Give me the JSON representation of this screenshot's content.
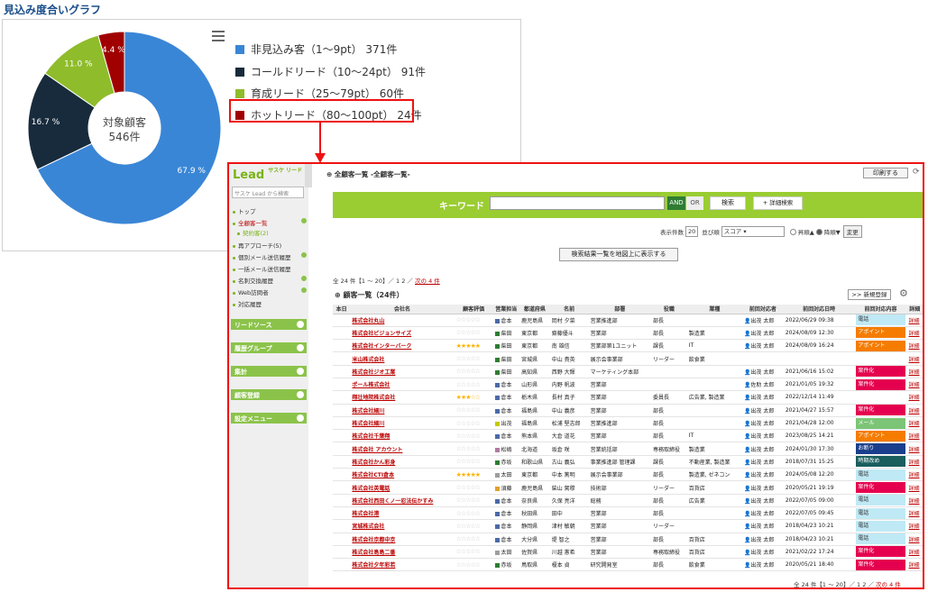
{
  "page_title": "見込み度合いグラフ",
  "chart_data": {
    "type": "pie",
    "center_label": "対象顧客",
    "center_value": "546件",
    "slices": [
      {
        "name": "非見込み客（1～9pt）",
        "count": "371件",
        "percent": 67.9,
        "label": "67.9 %",
        "color": "#3a86d6"
      },
      {
        "name": "コールドリード（10～24pt）",
        "count": "91件",
        "percent": 16.7,
        "label": "16.7 %",
        "color": "#172b3c"
      },
      {
        "name": "育成リード（25～79pt）",
        "count": "60件",
        "percent": 11.0,
        "label": "11.0 %",
        "color": "#8fbc2b"
      },
      {
        "name": "ホットリード（80～100pt）",
        "count": "24件",
        "percent": 4.4,
        "label": "4.4 %",
        "color": "#a00000"
      }
    ]
  },
  "app": {
    "logo": "Lead",
    "logo_sub": "サスケ リード",
    "search_placeholder": "サスケ Lead から検索",
    "nav": [
      {
        "label": "トップ",
        "selected": false,
        "sub": false
      },
      {
        "label": "全顧客一覧",
        "selected": true,
        "sub": false
      },
      {
        "label": "契約客(2)",
        "selected": false,
        "sub": true
      },
      {
        "label": "再アプローチ(5)",
        "selected": false,
        "sub": false
      },
      {
        "label": "個別メール送信履歴",
        "selected": false,
        "sub": false
      },
      {
        "label": "一括メール送信履歴",
        "selected": false,
        "sub": false
      },
      {
        "label": "名刺交換履歴",
        "selected": false,
        "sub": false
      },
      {
        "label": "Web訪問者",
        "selected": false,
        "sub": false
      },
      {
        "label": "対応履歴",
        "selected": false,
        "sub": false
      }
    ],
    "groups": [
      "リードソース",
      "履歴グループ",
      "集計",
      "顧客登録",
      "設定メニュー"
    ],
    "breadcrumb": "全顧客一覧 -全顧客一覧-",
    "print_label": "印刷する",
    "keyword_label": "キーワード",
    "and_label": "AND",
    "or_label": "OR",
    "search_label": "検索",
    "adv_search_label": "+ 詳細検索",
    "per_page_label": "表示件数",
    "per_page_value": "20",
    "sort_label": "並び順",
    "sort_value": "スコア",
    "asc_label": "昇順▲",
    "desc_label": "降順▼",
    "change_label": "変更",
    "map_label": "検索結果一覧を地図上に表示する",
    "count_text": "全 24 件【1 ～ 20】／ 1 2",
    "next_label": "次の 4 件",
    "list_title": "顧客一覧（24件）",
    "new_label": ">> 新規登録",
    "columns": [
      "本日",
      "会社名",
      "顧客評価",
      "営業担当",
      "都道府県",
      "名前",
      "部署",
      "役職",
      "業種",
      "前回対応者",
      "前回対応日時",
      "前回対応内容",
      "詳細"
    ],
    "rows": [
      [
        "株式会社丸山",
        "☆☆☆☆☆",
        "倉本",
        "鹿児島県",
        "岡村 夕菜",
        "営業推進部",
        "部長",
        "",
        "出茂 太郎",
        "2022/06/29 09:38",
        "電話",
        "詳細",
        false
      ],
      [
        "株式会社ビジョンサイズ",
        "☆☆☆☆☆",
        "柴田",
        "東京都",
        "齋藤優斗",
        "営業部",
        "部長",
        "製造業",
        "出茂 太郎",
        "2024/08/09 12:30",
        "アポイント",
        "詳細",
        false
      ],
      [
        "株式会社インターバーク",
        "★★★★★",
        "柴田",
        "東京都",
        "南 雄信",
        "営業部第1ユニット",
        "課長",
        "IT",
        "出茂 太郎",
        "2024/08/09 16:24",
        "アポイント",
        "詳細",
        true
      ],
      [
        "米山株式会社",
        "☆☆☆☆☆",
        "柴田",
        "宮城県",
        "中山 貴英",
        "展示会事業部",
        "リーダー",
        "飲食業",
        "",
        "",
        "",
        "詳細",
        false
      ],
      [
        "株式会社ジオ工業",
        "☆☆☆☆☆",
        "柴田",
        "高知県",
        "西野 大輝",
        "マーケティング本部",
        "",
        "",
        "出茂 太郎",
        "2021/06/16 15:02",
        "案件化",
        "詳細",
        false
      ],
      [
        "ポール株式会社",
        "☆☆☆☆☆",
        "倉本",
        "山形県",
        "内野 帆波",
        "営業部",
        "",
        "",
        "佐助 太郎",
        "2021/01/05 19:32",
        "案件化",
        "詳細",
        false
      ],
      [
        "翔壮地院株式会社",
        "★★★☆☆",
        "倉本",
        "栃木県",
        "長村 真子",
        "営業部",
        "委員長",
        "広告業, 製造業",
        "出茂 太郎",
        "2022/12/14 11:49",
        "",
        "詳細",
        true
      ],
      [
        "株式会社細川",
        "☆☆☆☆☆",
        "倉本",
        "福島県",
        "中山 義彦",
        "営業部",
        "部長",
        "",
        "出茂 太郎",
        "2021/04/27 15:57",
        "案件化",
        "詳細",
        false
      ],
      [
        "株式会社細川",
        "☆☆☆☆☆",
        "出茂",
        "福島県",
        "松浦 堅志郎",
        "営業推進部",
        "部長",
        "",
        "出茂 太郎",
        "2021/04/28 12:00",
        "メール",
        "詳細",
        false
      ],
      [
        "株式会社千葉翔",
        "☆☆☆☆☆",
        "倉本",
        "熊本県",
        "大倉 道花",
        "営業部",
        "部長",
        "IT",
        "出茂 太郎",
        "2023/08/25 14:21",
        "アポイント",
        "詳細",
        false
      ],
      [
        "株式会社 アカウント",
        "☆☆☆☆☆",
        "松嶋",
        "北海道",
        "坂倉 咲",
        "営業統括部",
        "専務取締役",
        "製造業",
        "出茂 太郎",
        "2024/01/30 17:30",
        "お断り",
        "詳細",
        false
      ],
      [
        "株式会社かん彩身",
        "☆☆☆☆☆",
        "赤坂",
        "和歌山県",
        "古山 義弘",
        "事業推進部 管理課",
        "課長",
        "不動産業, 製造業",
        "出茂 太郎",
        "2018/07/31 15:25",
        "時期改め",
        "詳細",
        false
      ],
      [
        "株式会社CTI倉本",
        "★★★★★",
        "太田",
        "東京都",
        "中本 篤明",
        "展示会事業部",
        "部長",
        "製造業, ゼネコン",
        "出茂 太郎",
        "2024/05/08 12:20",
        "電話",
        "詳細",
        true
      ],
      [
        "株式会社英電話",
        "☆☆☆☆☆",
        "須藤",
        "鹿児島県",
        "柴山 駕穆",
        "技術部",
        "リーダー",
        "百貨店",
        "出茂 太郎",
        "2020/05/21 19:19",
        "案件化",
        "詳細",
        false
      ],
      [
        "株式会社西田くノ一忍法伝かすみ",
        "☆☆☆☆☆",
        "倉本",
        "奈良県",
        "久保 亮洋",
        "総務",
        "部長",
        "広告業",
        "出茂 太郎",
        "2022/07/05 09:00",
        "電話",
        "詳細",
        false
      ],
      [
        "株式会社港",
        "☆☆☆☆☆",
        "倉本",
        "秋田県",
        "田中",
        "営業部",
        "部長",
        "",
        "出茂 太郎",
        "2022/07/05 09:45",
        "電話",
        "詳細",
        false
      ],
      [
        "宮城株式会社",
        "☆☆☆☆☆",
        "倉本",
        "静岡県",
        "津村 敏朝",
        "営業部",
        "リーダー",
        "",
        "出茂 太郎",
        "2018/04/23 10:21",
        "電話",
        "詳細",
        false
      ],
      [
        "株式会社京都中京",
        "☆☆☆☆☆",
        "倉本",
        "大分県",
        "堤 智之",
        "営業部",
        "部長",
        "百貨店",
        "出茂 太郎",
        "2018/04/23 10:21",
        "電話",
        "詳細",
        false
      ],
      [
        "株式会社島島二番",
        "☆☆☆☆☆",
        "太田",
        "佐賀県",
        "川越 憲希",
        "営業部",
        "専務取締役",
        "百貨店",
        "出茂 太郎",
        "2021/02/22 17:24",
        "案件化",
        "詳細",
        false
      ],
      [
        "株式会社夕年彩若",
        "☆☆☆☆☆",
        "赤坂",
        "鳥取県",
        "榎本 貞",
        "研究開発室",
        "部長",
        "飲食業",
        "出茂 太郎",
        "2020/05/21 18:40",
        "案件化",
        "詳細",
        false
      ]
    ],
    "footer_count": "全 24 件【1 ～ 20】／ 1 2",
    "footer_next": "次の 4 件",
    "tag_colors": {
      "電話": "#bfe9f5",
      "アポイント": "#f57c00",
      "案件化": "#e5004f",
      "メール": "#7cc576",
      "お断り": "#1a3e8c",
      "時期改め": "#1b5e5e"
    },
    "rep_colors": {
      "倉本": "#4a6aa8",
      "柴田": "#2e7d32",
      "出茂": "#c8c800",
      "松嶋": "#b07aa0",
      "赤坂": "#2e7d32",
      "太田": "#9e9e9e",
      "須藤": "#e0a030"
    }
  }
}
